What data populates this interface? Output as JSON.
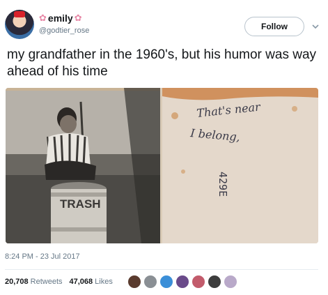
{
  "user": {
    "display_name": "emily",
    "flower_glyph": "✿",
    "handle": "@godtier_rose"
  },
  "actions": {
    "follow_label": "Follow"
  },
  "tweet": {
    "text": "my grandfather in the 1960's, but his humor was way ahead of his time",
    "timestamp": "8:24 PM - 23 Jul 2017"
  },
  "photos": {
    "front": {
      "trash_text": "TRASH"
    },
    "back": {
      "line1": "That's near",
      "line2": "I belong,",
      "code": "429E"
    }
  },
  "stats": {
    "retweets_count": "20,708",
    "retweets_label": "Retweets",
    "likes_count": "47,068",
    "likes_label": "Likes"
  },
  "liker_colors": [
    "#5a3b2e",
    "#8a8f94",
    "#3b8fd8",
    "#6a4a8a",
    "#c25b6b",
    "#3d3d3d",
    "#b9a9c9"
  ]
}
